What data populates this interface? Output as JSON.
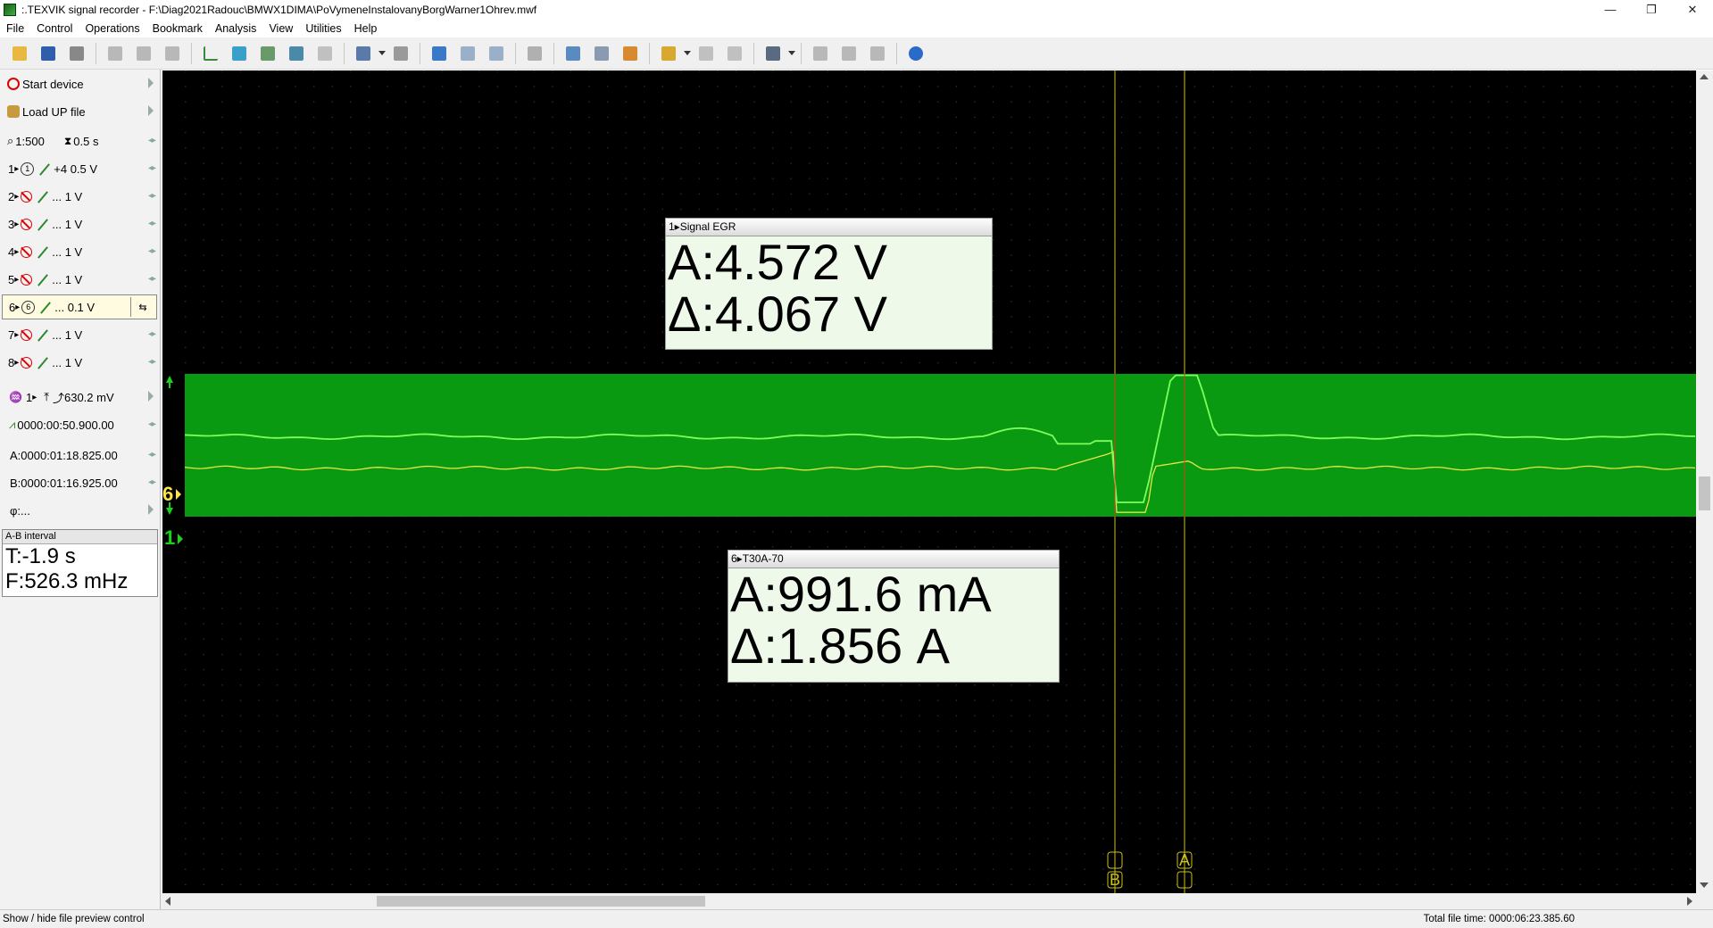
{
  "window": {
    "title": ":.TEXVIK  signal recorder - F:\\Diag2021Radouc\\BMWX1DIMA\\PoVymeneInstalovanyBorgWarner1Ohrev.mwf",
    "minimize": "—",
    "restore": "❐",
    "close": "✕"
  },
  "menu": [
    "File",
    "Control",
    "Operations",
    "Bookmark",
    "Analysis",
    "View",
    "Utilities",
    "Help"
  ],
  "sidebar": {
    "start_device": "Start device",
    "load_up_file": "Load UP file",
    "zoom": "1:500",
    "time_div": "0.5 s",
    "channels": [
      {
        "num": "1",
        "badge": "1",
        "enabled": true,
        "scale": "+4 0.5 V"
      },
      {
        "num": "2",
        "badge": "",
        "enabled": false,
        "scale": "... 1 V"
      },
      {
        "num": "3",
        "badge": "",
        "enabled": false,
        "scale": "... 1 V"
      },
      {
        "num": "4",
        "badge": "",
        "enabled": false,
        "scale": "... 1 V"
      },
      {
        "num": "5",
        "badge": "",
        "enabled": false,
        "scale": "... 1 V"
      },
      {
        "num": "6",
        "badge": "6",
        "enabled": true,
        "scale": "... 0.1 V"
      },
      {
        "num": "7",
        "badge": "",
        "enabled": false,
        "scale": "... 1 V"
      },
      {
        "num": "8",
        "badge": "",
        "enabled": false,
        "scale": "... 1 V"
      }
    ],
    "trigger": {
      "channel": "1",
      "level": "630.2 mV"
    },
    "position": "0000:00:50.900.00",
    "cursor_a": "A:0000:01:18.825.00",
    "cursor_b": "B:0000:01:16.925.00",
    "phi": "φ:..."
  },
  "ab_interval": {
    "title": "A-B interval",
    "t": "T:-1.9 s",
    "f": "F:526.3 mHz"
  },
  "readouts": [
    {
      "title": "1▸Signal EGR",
      "a": "A:4.572 V",
      "delta": "Δ:4.067 V"
    },
    {
      "title": "6▸T30A-70",
      "a": "A:991.6 mA",
      "delta": "Δ:1.856 A"
    }
  ],
  "markers": {
    "ch6": "6",
    "ch1": "1",
    "cursor_a": "A",
    "cursor_b": "B"
  },
  "status": {
    "left": "Show / hide file preview control",
    "right": "Total file time: 0000:06:23.385.60"
  },
  "colors": {
    "scope_bg": "#000000",
    "band": "#0a9a12",
    "trace_ch1": "#7dff5a",
    "trace_ch6": "#e6e646",
    "cursor_a": "#c8c020",
    "cursor_b": "#c8c020"
  }
}
